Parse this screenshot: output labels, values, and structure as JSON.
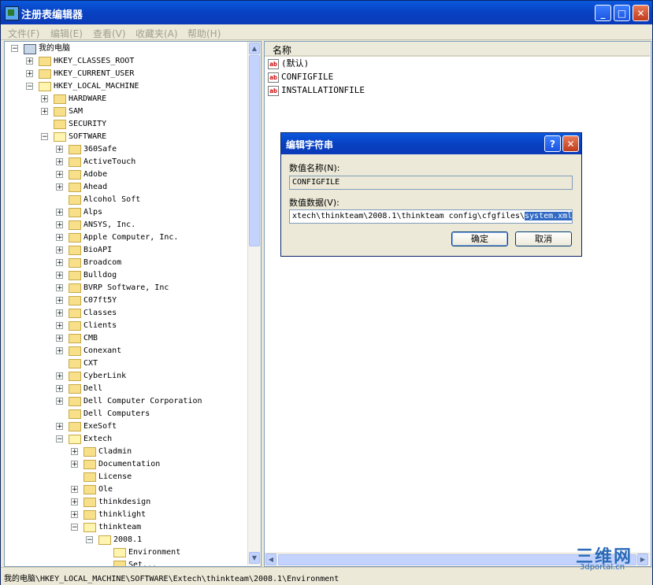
{
  "window": {
    "title": "注册表编辑器"
  },
  "title_buttons": {
    "minimize": "_",
    "maximize": "□",
    "close": "✕"
  },
  "menu": [
    "文件(F)",
    "编辑(E)",
    "查看(V)",
    "收藏夹(A)",
    "帮助(H)"
  ],
  "tree": [
    {
      "label": "我的电脑",
      "depth": 0,
      "expander": "-",
      "icon": "computer"
    },
    {
      "label": "HKEY_CLASSES_ROOT",
      "depth": 1,
      "expander": "+",
      "icon": "folder"
    },
    {
      "label": "HKEY_CURRENT_USER",
      "depth": 1,
      "expander": "+",
      "icon": "folder"
    },
    {
      "label": "HKEY_LOCAL_MACHINE",
      "depth": 1,
      "expander": "-",
      "icon": "folder-open"
    },
    {
      "label": "HARDWARE",
      "depth": 2,
      "expander": "+",
      "icon": "folder"
    },
    {
      "label": "SAM",
      "depth": 2,
      "expander": "+",
      "icon": "folder"
    },
    {
      "label": "SECURITY",
      "depth": 2,
      "expander": "",
      "icon": "folder"
    },
    {
      "label": "SOFTWARE",
      "depth": 2,
      "expander": "-",
      "icon": "folder-open"
    },
    {
      "label": "360Safe",
      "depth": 3,
      "expander": "+",
      "icon": "folder"
    },
    {
      "label": "ActiveTouch",
      "depth": 3,
      "expander": "+",
      "icon": "folder"
    },
    {
      "label": "Adobe",
      "depth": 3,
      "expander": "+",
      "icon": "folder"
    },
    {
      "label": "Ahead",
      "depth": 3,
      "expander": "+",
      "icon": "folder"
    },
    {
      "label": "Alcohol Soft",
      "depth": 3,
      "expander": "",
      "icon": "folder"
    },
    {
      "label": "Alps",
      "depth": 3,
      "expander": "+",
      "icon": "folder"
    },
    {
      "label": "ANSYS, Inc.",
      "depth": 3,
      "expander": "+",
      "icon": "folder"
    },
    {
      "label": "Apple Computer, Inc.",
      "depth": 3,
      "expander": "+",
      "icon": "folder"
    },
    {
      "label": "BioAPI",
      "depth": 3,
      "expander": "+",
      "icon": "folder"
    },
    {
      "label": "Broadcom",
      "depth": 3,
      "expander": "+",
      "icon": "folder"
    },
    {
      "label": "Bulldog",
      "depth": 3,
      "expander": "+",
      "icon": "folder"
    },
    {
      "label": "BVRP Software, Inc",
      "depth": 3,
      "expander": "+",
      "icon": "folder"
    },
    {
      "label": "C07ft5Y",
      "depth": 3,
      "expander": "+",
      "icon": "folder"
    },
    {
      "label": "Classes",
      "depth": 3,
      "expander": "+",
      "icon": "folder"
    },
    {
      "label": "Clients",
      "depth": 3,
      "expander": "+",
      "icon": "folder"
    },
    {
      "label": "CMB",
      "depth": 3,
      "expander": "+",
      "icon": "folder"
    },
    {
      "label": "Conexant",
      "depth": 3,
      "expander": "+",
      "icon": "folder"
    },
    {
      "label": "CXT",
      "depth": 3,
      "expander": "",
      "icon": "folder"
    },
    {
      "label": "CyberLink",
      "depth": 3,
      "expander": "+",
      "icon": "folder"
    },
    {
      "label": "Dell",
      "depth": 3,
      "expander": "+",
      "icon": "folder"
    },
    {
      "label": "Dell Computer Corporation",
      "depth": 3,
      "expander": "+",
      "icon": "folder"
    },
    {
      "label": "Dell Computers",
      "depth": 3,
      "expander": "",
      "icon": "folder"
    },
    {
      "label": "ExeSoft",
      "depth": 3,
      "expander": "+",
      "icon": "folder"
    },
    {
      "label": "Extech",
      "depth": 3,
      "expander": "-",
      "icon": "folder-open"
    },
    {
      "label": "Cladmin",
      "depth": 4,
      "expander": "+",
      "icon": "folder"
    },
    {
      "label": "Documentation",
      "depth": 4,
      "expander": "+",
      "icon": "folder"
    },
    {
      "label": "License",
      "depth": 4,
      "expander": "",
      "icon": "folder"
    },
    {
      "label": "Ole",
      "depth": 4,
      "expander": "+",
      "icon": "folder"
    },
    {
      "label": "thinkdesign",
      "depth": 4,
      "expander": "+",
      "icon": "folder"
    },
    {
      "label": "thinklight",
      "depth": 4,
      "expander": "+",
      "icon": "folder"
    },
    {
      "label": "thinkteam",
      "depth": 4,
      "expander": "-",
      "icon": "folder-open"
    },
    {
      "label": "2008.1",
      "depth": 5,
      "expander": "-",
      "icon": "folder-open"
    },
    {
      "label": "Environment",
      "depth": 6,
      "expander": "",
      "icon": "folder-open"
    },
    {
      "label": "Set...",
      "depth": 6,
      "expander": "",
      "icon": "folder"
    }
  ],
  "list": {
    "column_name": "名称",
    "values": [
      {
        "name": "(默认)",
        "icon": "string-value-icon"
      },
      {
        "name": "CONFIGFILE",
        "icon": "string-value-icon"
      },
      {
        "name": "INSTALLATIONFILE",
        "icon": "string-value-icon"
      }
    ]
  },
  "dialog": {
    "title": "编辑字符串",
    "help_button": "?",
    "close_button": "✕",
    "name_label": "数值名称(N):",
    "name_value": "CONFIGFILE",
    "data_label": "数值数据(V):",
    "data_value_prefix": "xtech\\thinkteam\\2008.1\\thinkteam config\\cfgfiles\\",
    "data_value_selected": "system.xml",
    "ok_label": "确定",
    "cancel_label": "取消"
  },
  "status": {
    "path": "我的电脑\\HKEY_LOCAL_MACHINE\\SOFTWARE\\Extech\\thinkteam\\2008.1\\Environment"
  },
  "watermark": {
    "text": "三维网",
    "url": "3dportal.cn"
  }
}
